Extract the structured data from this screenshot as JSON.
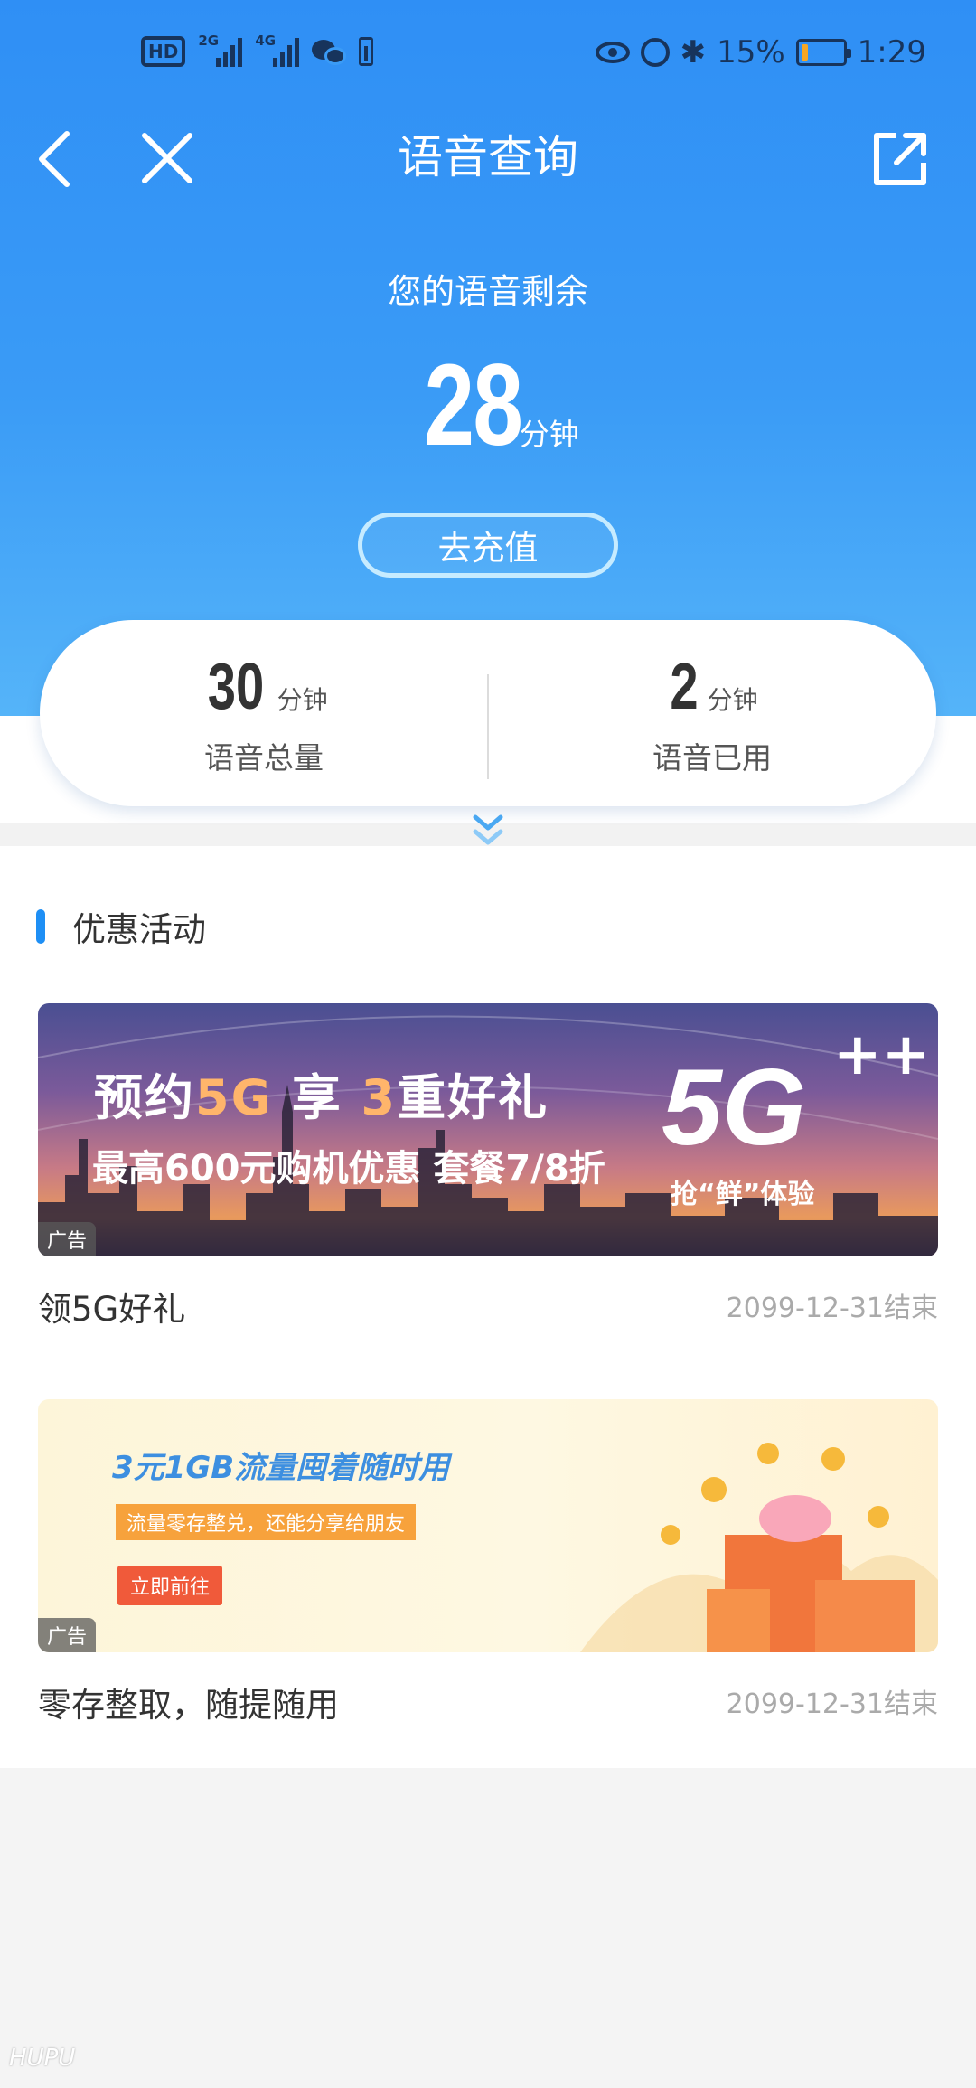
{
  "status_bar": {
    "hd_label": "HD",
    "signal1_net": "2G",
    "signal2_net": "4G",
    "battery_text": "15%",
    "battery_level": 0.15,
    "time": "1:29",
    "bluetooth_glyph": "✱"
  },
  "nav": {
    "title": "语音查询",
    "back_icon": "chevron-left",
    "close_icon": "close",
    "share_icon": "share-external"
  },
  "summary": {
    "remaining_label": "您的语音剩余",
    "remaining_value": "28",
    "remaining_unit": "分钟",
    "recharge_button": "去充值"
  },
  "stats": [
    {
      "value": "30",
      "unit": "分钟",
      "label": "语音总量"
    },
    {
      "value": "2",
      "unit": "分钟",
      "label": "语音已用"
    }
  ],
  "section": {
    "title": "优惠活动"
  },
  "promos": [
    {
      "banner_line1_a": "预约",
      "banner_line1_b": "5G",
      "banner_line1_c": " 享 ",
      "banner_line1_d": "3",
      "banner_line1_e": "重好礼",
      "banner_line2": "最高600元购机优惠 套餐7/8折",
      "banner_logo": "5G",
      "banner_plus": "++",
      "banner_sub": "抢“鲜”体验",
      "ad_tag": "广告",
      "title": "领5G好礼",
      "end_date": "2099-12-31结束"
    },
    {
      "banner_line1": "3元1GB流量囤着随时用",
      "banner_line2": "流量零存整兑，还能分享给朋友",
      "banner_button": "立即前往",
      "ad_tag": "广告",
      "title": "零存整取，随提随用",
      "end_date": "2099-12-31结束"
    }
  ],
  "colors": {
    "header_blue": "#2f8ff5",
    "accent_blue": "#1e8ff5",
    "battery_orange": "#f6a623"
  }
}
